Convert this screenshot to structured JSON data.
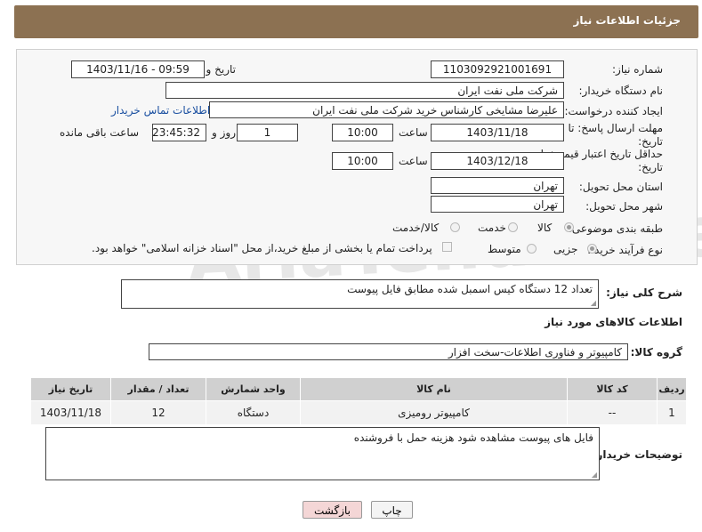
{
  "header": {
    "title": "جزئیات اطلاعات نیاز"
  },
  "form": {
    "need_number_label": "شماره نیاز:",
    "need_number": "1103092921001691",
    "announce_label": "تاریخ و ساعت اعلان عمومی:",
    "announce_value": "1403/11/16 - 09:59",
    "buyer_org_label": "نام دستگاه خریدار:",
    "buyer_org": "شرکت ملی نفت ایران",
    "creator_label": "ایجاد کننده درخواست:",
    "creator": "علیرضا مشایخی کارشناس خرید  شرکت ملی نفت ایران",
    "contact_link": "اطلاعات تماس خریدار",
    "deadline_label": "مهلت ارسال پاسخ: تا تاریخ:",
    "deadline_date": "1403/11/18",
    "time_label": "ساعت",
    "deadline_time": "10:00",
    "days_value": "1",
    "days_label": "روز و",
    "remaining_time": "23:45:32",
    "remaining_label": "ساعت باقی مانده",
    "validity_label": "حداقل تاریخ اعتبار قیمت: تا تاریخ:",
    "validity_date": "1403/12/18",
    "validity_time": "10:00",
    "province_label": "استان محل تحویل:",
    "province": "تهران",
    "city_label": "شهر محل تحویل:",
    "city": "تهران",
    "category_label": "طبقه بندی موضوعی:",
    "category_options": [
      "کالا",
      "خدمت",
      "کالا/خدمت"
    ],
    "process_label": "نوع فرآیند خرید :",
    "process_options": [
      "جزیی",
      "متوسط"
    ],
    "payment_note": "پرداخت تمام یا بخشی از مبلغ خرید،از محل \"اسناد خزانه اسلامی\" خواهد بود."
  },
  "description": {
    "label": "شرح کلی نیاز:",
    "text": "تعداد 12 دستگاه کیس اسمبل شده مطابق فایل پیوست"
  },
  "goods": {
    "section_title": "اطلاعات کالاهای مورد نیاز",
    "group_label": "گروه کالا:",
    "group_value": "کامپیوتر و فناوری اطلاعات-سخت افزار",
    "columns": [
      "ردیف",
      "کد کالا",
      "نام کالا",
      "واحد شمارش",
      "تعداد / مقدار",
      "تاریخ نیاز"
    ],
    "rows": [
      {
        "row": "1",
        "code": "--",
        "name": "کامپیوتر رومیزی",
        "unit": "دستگاه",
        "qty": "12",
        "date": "1403/11/18"
      }
    ]
  },
  "buyer_notes": {
    "label": "توضیحات خریدار:",
    "text": "فایل های پیوست مشاهده شود هزینه حمل با فروشنده"
  },
  "buttons": {
    "print": "چاپ",
    "back": "بازگشت"
  },
  "watermark": "AriaTender.neT",
  "colors": {
    "header": "#8c7152",
    "link": "#1a4fa0",
    "back_button": "#f4d6d6"
  }
}
